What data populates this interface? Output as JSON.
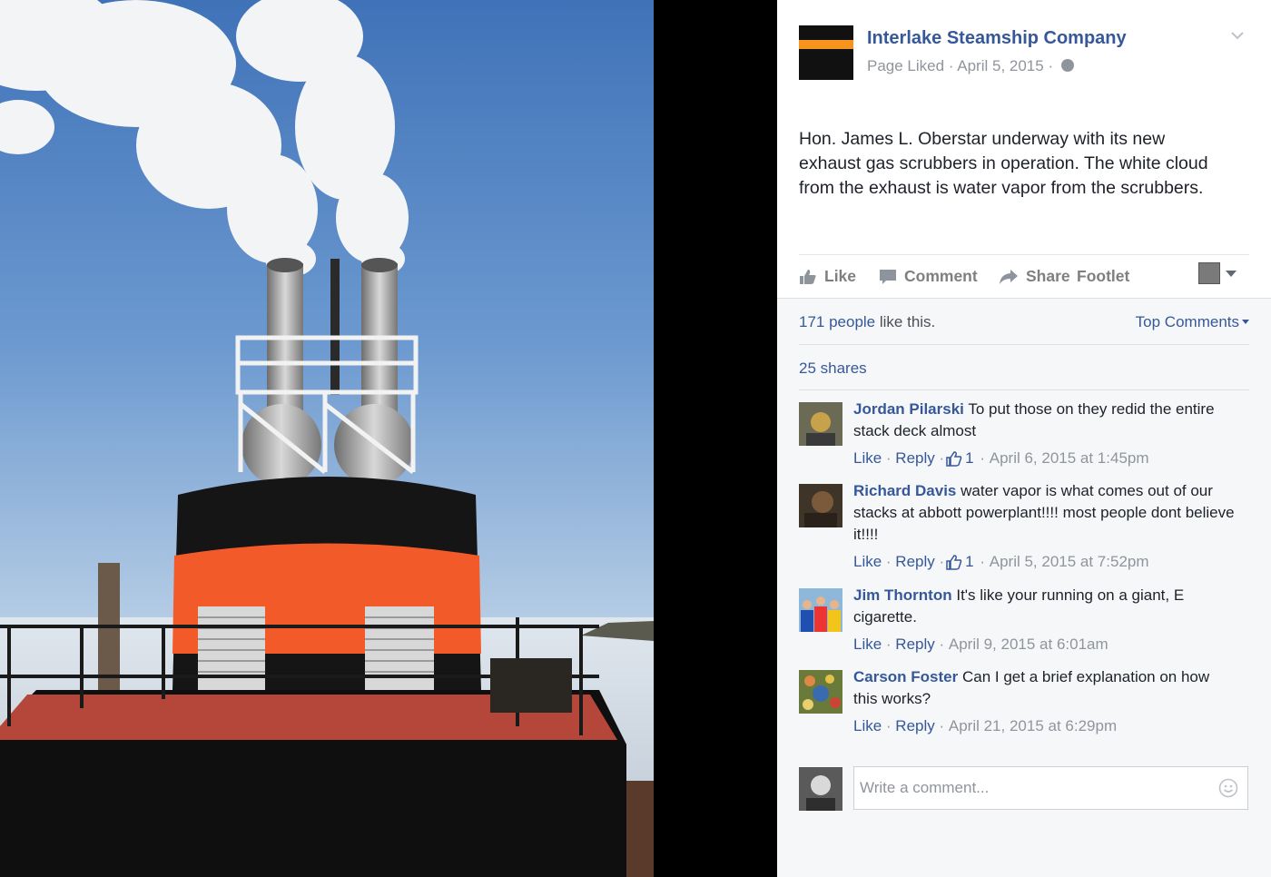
{
  "post": {
    "page_name": "Interlake Steamship Company",
    "status": "Page Liked",
    "date": "April 5, 2015",
    "text": "Hon. James L. Oberstar underway with its new exhaust gas scrubbers in operation. The white cloud from the exhaust is water vapor from the scrubbers."
  },
  "actions": {
    "like": "Like",
    "comment": "Comment",
    "share": "Share",
    "footlet": "Footlet"
  },
  "summary": {
    "likes_count": "171 people",
    "likes_suffix": " like this.",
    "top_comments": "Top Comments",
    "shares": "25 shares"
  },
  "comments": [
    {
      "name": "Jordan Pilarski",
      "text": "To put those on they redid the entire stack deck almost",
      "like": "Like",
      "reply": "Reply",
      "reactions": "1",
      "timestamp": "April 6, 2015 at 1:45pm"
    },
    {
      "name": "Richard Davis",
      "text": "water vapor is what comes out of our stacks at abbott powerplant!!!! most people dont believe it!!!!",
      "like": "Like",
      "reply": "Reply",
      "reactions": "1",
      "timestamp": "April 5, 2015 at 7:52pm"
    },
    {
      "name": "Jim Thornton",
      "text": "It's like your running on a giant, E cigarette.",
      "like": "Like",
      "reply": "Reply",
      "timestamp": "April 9, 2015 at 6:01am"
    },
    {
      "name": "Carson Foster",
      "text": "Can I get a brief explanation on how this works?",
      "like": "Like",
      "reply": "Reply",
      "timestamp": "April 21, 2015 at 6:29pm"
    }
  ],
  "composer": {
    "placeholder": "Write a comment..."
  },
  "colors": {
    "link": "#365899",
    "muted": "#90949c",
    "stack_orange": "#f25a2a"
  }
}
